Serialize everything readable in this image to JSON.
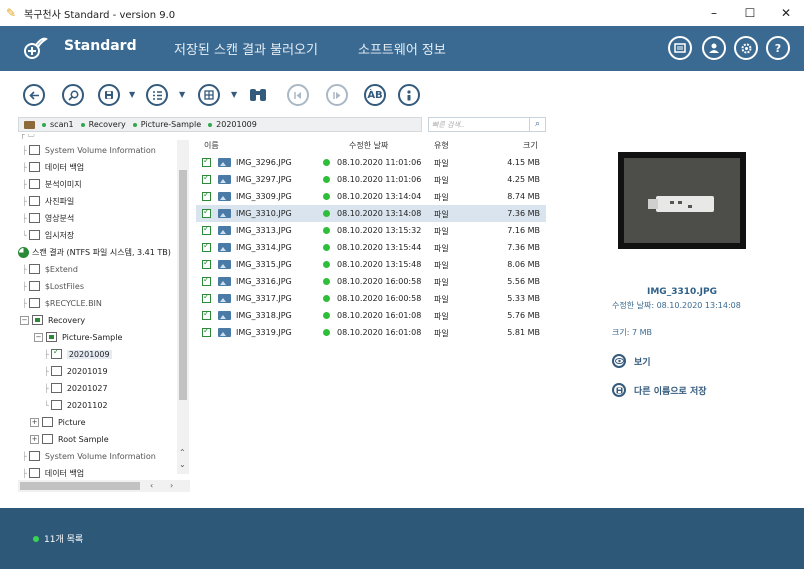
{
  "window": {
    "title": "복구천사 Standard - version 9.0",
    "minimize": "–",
    "maximize": "☐",
    "close": "✕"
  },
  "header": {
    "brand": "Standard",
    "nav": [
      "저장된 스캔 결과 불러오기",
      "소프트웨어 정보"
    ],
    "icons": [
      "message-icon",
      "user-icon",
      "settings-icon",
      "help-icon"
    ],
    "help_label": "?"
  },
  "toolbar": {
    "buttons": [
      "back-icon",
      "search-icon",
      "save-icon",
      "list-view-icon",
      "grid-view-icon",
      "find-icon",
      "prev-icon",
      "next-icon",
      "case-icon",
      "info-icon"
    ],
    "case_label": "ÀB"
  },
  "breadcrumb": [
    "scan1",
    "Recovery",
    "Picture-Sample",
    "20201009"
  ],
  "search": {
    "placeholder": "빠른 검색.."
  },
  "tree": {
    "items": [
      {
        "label": "System Volume Information",
        "depth": 0
      },
      {
        "label": "데이터 백업",
        "depth": 0
      },
      {
        "label": "분석이미지",
        "depth": 0
      },
      {
        "label": "사진파일",
        "depth": 0
      },
      {
        "label": "영상분석",
        "depth": 0
      },
      {
        "label": "임시저장",
        "depth": 0
      },
      {
        "label": "스캔 결과 (NTFS 파일 시스템, 3.41 TB)",
        "depth": 0
      },
      {
        "label": "$Extend",
        "depth": 0
      },
      {
        "label": "$LostFiles",
        "depth": 0
      },
      {
        "label": "$RECYCLE.BIN",
        "depth": 0
      },
      {
        "label": "Recovery",
        "depth": 0
      },
      {
        "label": "Picture-Sample",
        "depth": 1
      },
      {
        "label": "20201009",
        "depth": 2
      },
      {
        "label": "20201019",
        "depth": 2
      },
      {
        "label": "20201027",
        "depth": 2
      },
      {
        "label": "20201102",
        "depth": 2
      },
      {
        "label": "Picture",
        "depth": 1
      },
      {
        "label": "Root Sample",
        "depth": 1
      },
      {
        "label": "System Volume Information",
        "depth": 0
      },
      {
        "label": "데이터 백업",
        "depth": 0
      }
    ]
  },
  "list": {
    "headers": {
      "name": "이름",
      "date": "수정한 날짜",
      "type": "유형",
      "size": "크기"
    },
    "rows": [
      {
        "name": "IMG_3296.JPG",
        "date": "08.10.2020 11:01:06",
        "type": "파일",
        "size": "4.15 MB"
      },
      {
        "name": "IMG_3297.JPG",
        "date": "08.10.2020 11:01:06",
        "type": "파일",
        "size": "4.25 MB"
      },
      {
        "name": "IMG_3309.JPG",
        "date": "08.10.2020 13:14:04",
        "type": "파일",
        "size": "8.74 MB"
      },
      {
        "name": "IMG_3310.JPG",
        "date": "08.10.2020 13:14:08",
        "type": "파일",
        "size": "7.36 MB"
      },
      {
        "name": "IMG_3313.JPG",
        "date": "08.10.2020 13:15:32",
        "type": "파일",
        "size": "7.16 MB"
      },
      {
        "name": "IMG_3314.JPG",
        "date": "08.10.2020 13:15:44",
        "type": "파일",
        "size": "7.36 MB"
      },
      {
        "name": "IMG_3315.JPG",
        "date": "08.10.2020 13:15:48",
        "type": "파일",
        "size": "8.06 MB"
      },
      {
        "name": "IMG_3316.JPG",
        "date": "08.10.2020 16:00:58",
        "type": "파일",
        "size": "5.56 MB"
      },
      {
        "name": "IMG_3317.JPG",
        "date": "08.10.2020 16:00:58",
        "type": "파일",
        "size": "5.33 MB"
      },
      {
        "name": "IMG_3318.JPG",
        "date": "08.10.2020 16:01:08",
        "type": "파일",
        "size": "5.76 MB"
      },
      {
        "name": "IMG_3319.JPG",
        "date": "08.10.2020 16:01:08",
        "type": "파일",
        "size": "5.81 MB"
      }
    ]
  },
  "preview": {
    "name": "IMG_3310.JPG",
    "modified": "수정한 날짜: 08.10.2020 13:14:08",
    "size": "크기: 7 MB",
    "view_label": "보기",
    "save_as_label": "다른 이름으로 저장"
  },
  "status": {
    "text": "11개 목록"
  }
}
